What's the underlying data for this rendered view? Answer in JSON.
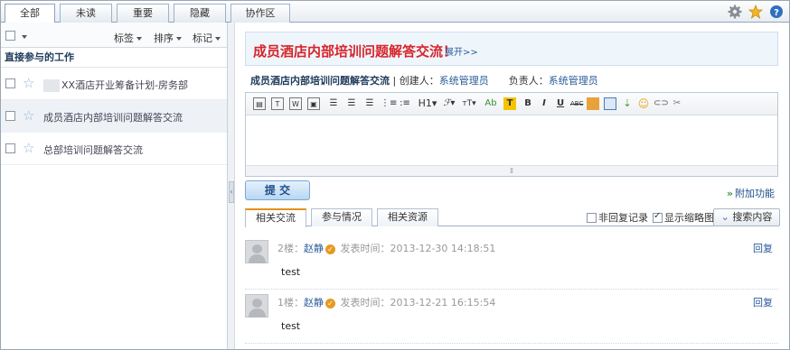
{
  "top_tabs": [
    {
      "label": "全部",
      "active": true
    },
    {
      "label": "未读"
    },
    {
      "label": "重要"
    },
    {
      "label": "隐藏"
    },
    {
      "label": "协作区"
    }
  ],
  "top_icons": [
    "gear-icon",
    "star-icon",
    "help-icon"
  ],
  "left": {
    "toolbar": {
      "tag_label": "标签",
      "sort_label": "排序",
      "mark_label": "标记"
    },
    "section_title": "直接参与的工作",
    "items": [
      {
        "label": "XX酒店开业筹备计划-房务部",
        "selected": false
      },
      {
        "label": "成员酒店内部培训问题解答交流",
        "selected": true
      },
      {
        "label": "总部培训问题解答交流",
        "selected": false
      }
    ]
  },
  "right": {
    "banner_title": "成员酒店内部培训问题解答交流！",
    "banner_expand": "展开>>",
    "meta": {
      "topic": "成员酒店内部培训问题解答交流",
      "sep": " | ",
      "creator_label": "创建人：",
      "creator": "系统管理员",
      "owner_label": "负责人：",
      "owner": "系统管理员"
    },
    "editor_tools": [
      "paste-icon",
      "paste-text-icon",
      "paste-word-icon",
      "paste-image-icon",
      "align-left-icon",
      "align-center-icon",
      "align-right-icon",
      "ordered-list-icon",
      "unordered-list-icon",
      "H1",
      "font-family-icon",
      "font-size-icon",
      "Ab",
      "T",
      "B",
      "I",
      "U",
      "strike-icon",
      "highlight-icon",
      "table-icon",
      "insert-icon",
      "emoji-icon",
      "link-icon",
      "unlink-icon"
    ],
    "submit_label": "提 交",
    "extra_label": "附加功能",
    "content_tabs": [
      {
        "label": "相关交流",
        "active": true
      },
      {
        "label": "参与情况"
      },
      {
        "label": "相关资源"
      }
    ],
    "opt_no_reply": "非回复记录",
    "opt_thumbnail": "显示缩略图",
    "thumbnail_checked": true,
    "search_label": "搜索内容",
    "posts": [
      {
        "floor": "2楼：",
        "user": "赵静",
        "time_label": "发表时间：",
        "time": "2013-12-30 14:18:51",
        "reply": "回复",
        "body": "test"
      },
      {
        "floor": "1楼：",
        "user": "赵静",
        "time_label": "发表时间：",
        "time": "2013-12-21 16:15:54",
        "reply": "回复",
        "body": "test"
      }
    ]
  }
}
